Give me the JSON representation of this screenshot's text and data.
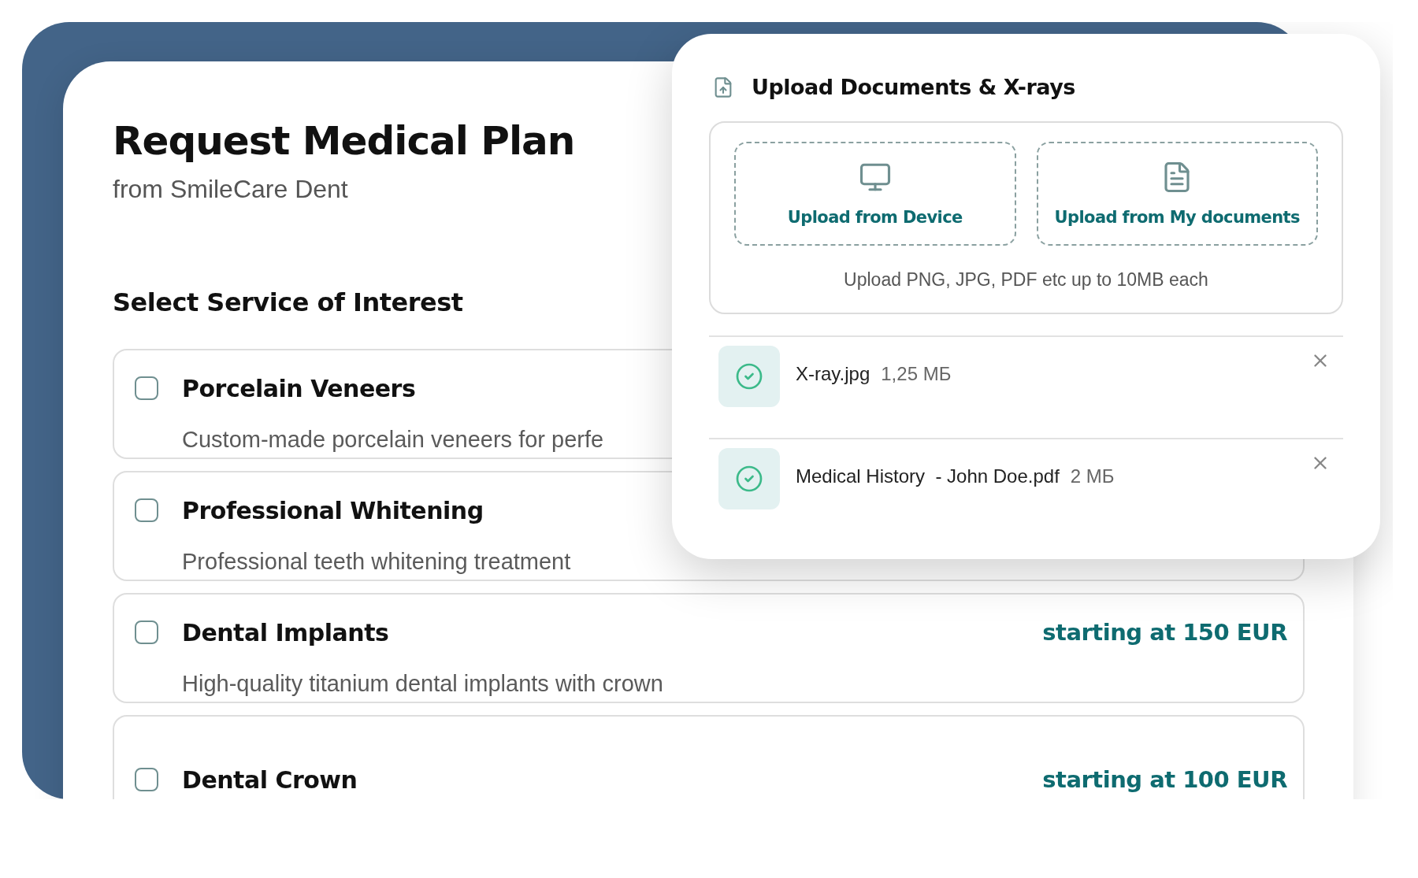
{
  "title": "Request Medical Plan",
  "subtitle": "from SmileCare Dent",
  "section_title": "Select Service of Interest",
  "services": [
    {
      "name": "Porcelain Veneers",
      "description": "Custom-made porcelain veneers for perfe",
      "checked": false
    },
    {
      "name": "Professional Whitening",
      "description": "Professional teeth whitening treatment",
      "checked": false
    },
    {
      "name": "Dental Implants",
      "description": "High-quality titanium dental implants with crown",
      "price": "starting at 150 EUR",
      "checked": false
    },
    {
      "name": "Dental Crown",
      "price": "starting at 100 EUR",
      "checked": false
    }
  ],
  "upload": {
    "title": "Upload Documents & X-rays",
    "options": [
      {
        "kind": "device",
        "label": "Upload from Device"
      },
      {
        "kind": "documents",
        "label": "Upload from My documents"
      }
    ],
    "hint": "Upload PNG, JPG, PDF etc up to 10MB each",
    "files": [
      {
        "name": "X-ray.jpg",
        "size": "1,25 МБ",
        "done": true
      },
      {
        "name": "Medical History  - John Doe.pdf",
        "size": "2 МБ",
        "done": true
      }
    ]
  }
}
